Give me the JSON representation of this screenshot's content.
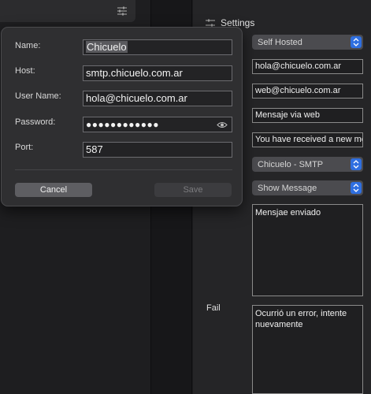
{
  "settings": {
    "title": "Settings",
    "hosting_select": "Self Hosted",
    "from_email": "hola@chicuelo.com.ar",
    "reply_email": "web@chicuelo.com.ar",
    "subject": "Mensaje via web",
    "body_preview": "You have received a new mes",
    "smtp_select": "Chicuelo - SMTP",
    "action_select": "Show Message",
    "success_message": "Mensjae enviado",
    "fail_label": "Fail",
    "fail_message": "Ocurrió un error, intente nuevamente"
  },
  "popover": {
    "name_label": "Name:",
    "name_value": "Chicuelo",
    "host_label": "Host:",
    "host_value": "smtp.chicuelo.com.ar",
    "user_label": "User Name:",
    "user_value": "hola@chicuelo.com.ar",
    "password_label": "Password:",
    "password_value": "●●●●●●●●●●●●",
    "port_label": "Port:",
    "port_value": "587",
    "cancel_label": "Cancel",
    "save_label": "Save"
  },
  "icons": {
    "toolbar": "sliders-icon",
    "settings": "sliders-icon",
    "password_toggle": "eye-icon",
    "select_stepper": "chevron-updown-icon"
  },
  "colors": {
    "accent": "#2f6fe0",
    "background": "#1c1c1e",
    "panel": "#252527"
  }
}
